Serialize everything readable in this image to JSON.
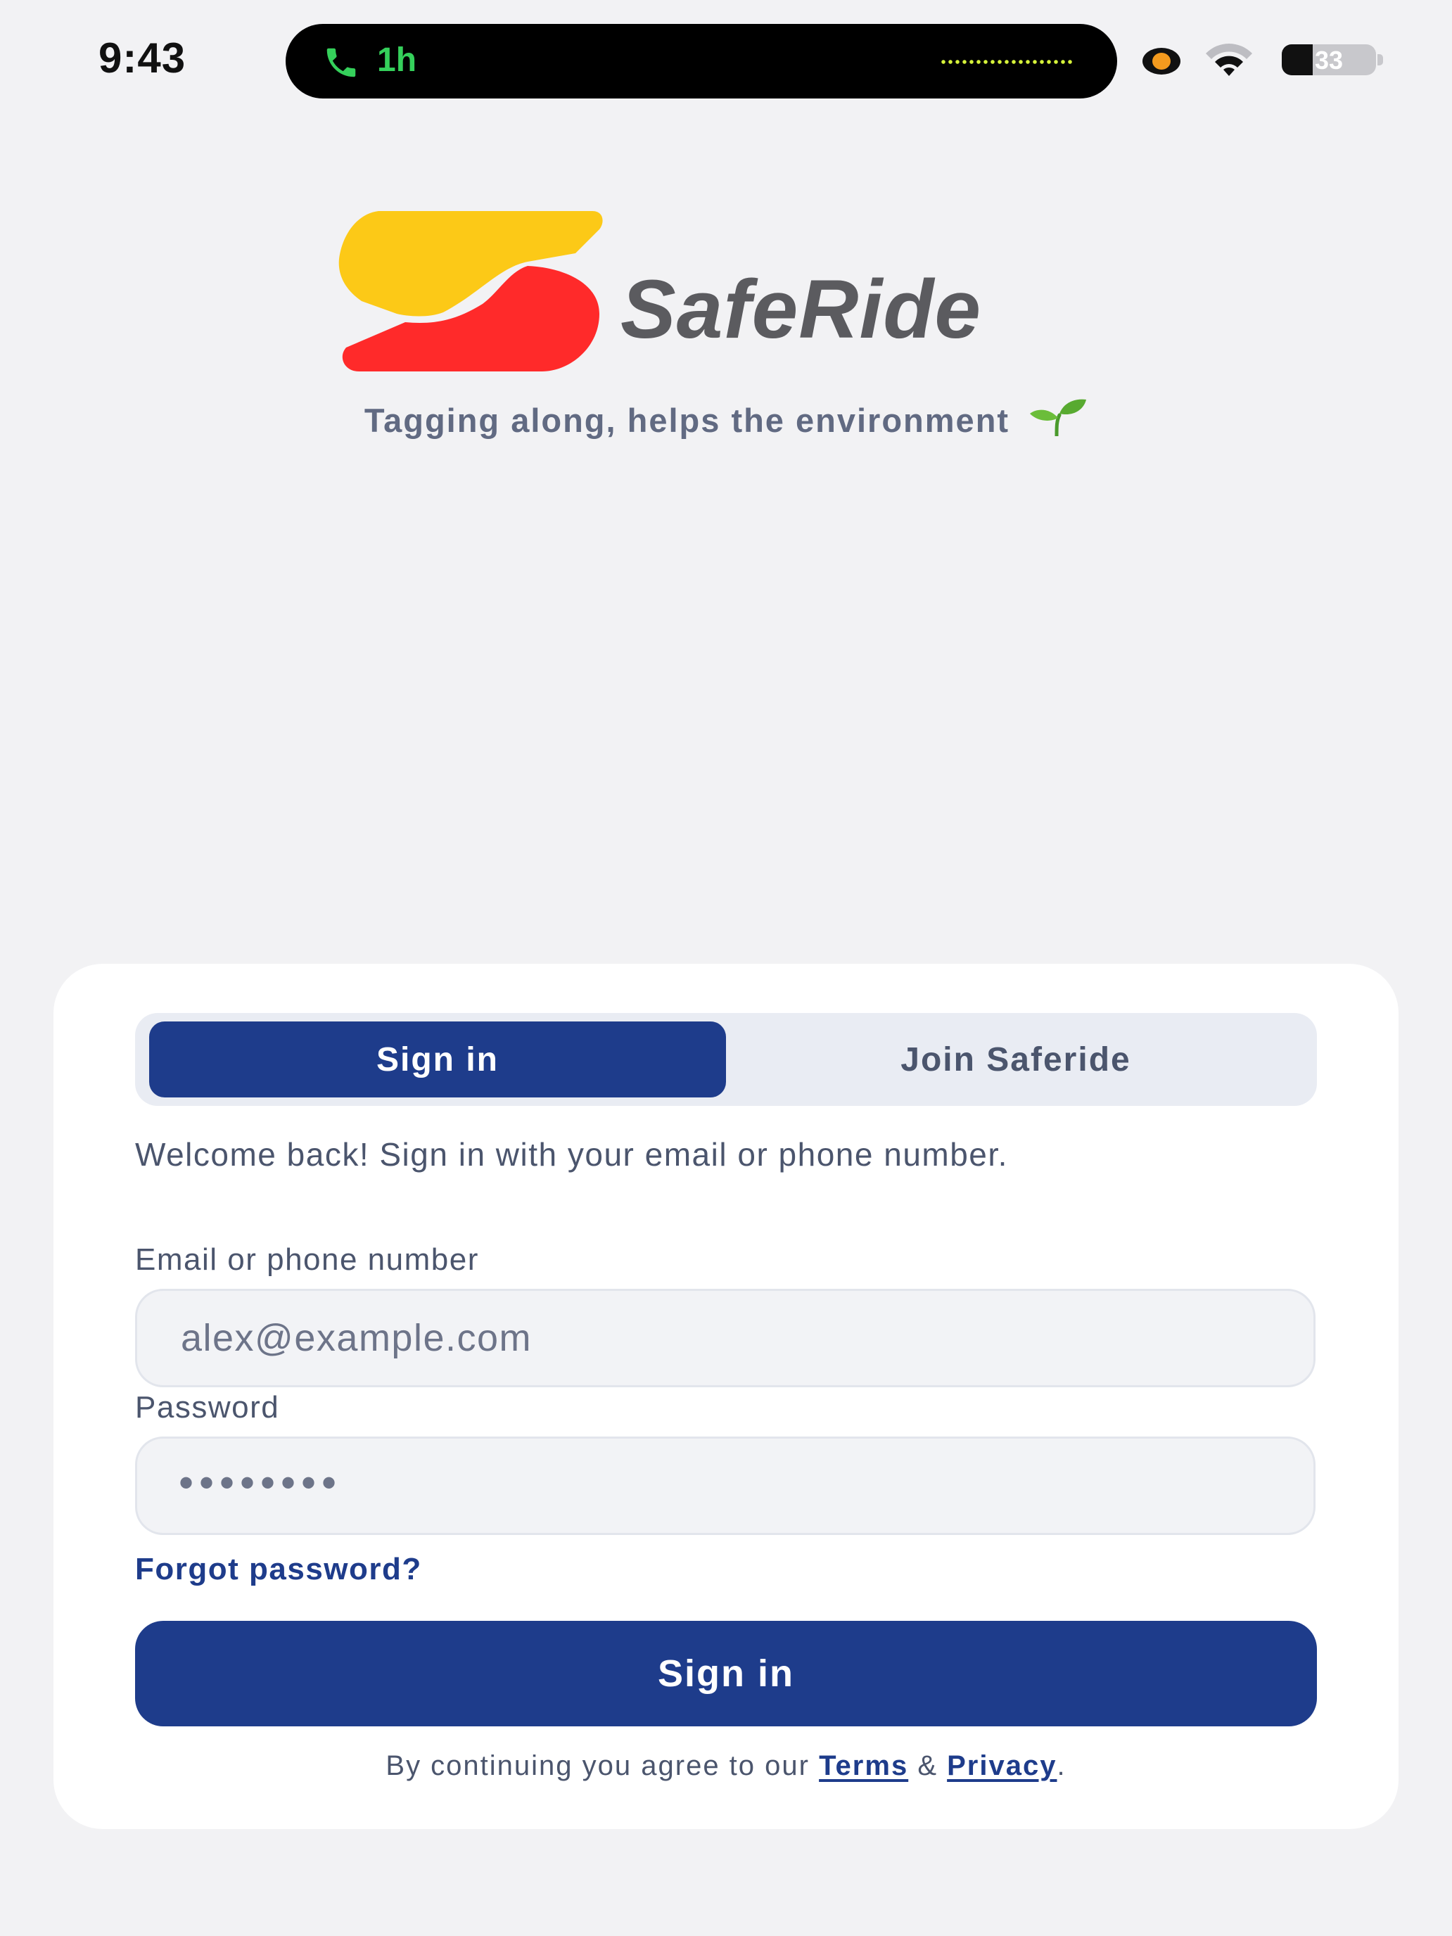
{
  "status_bar": {
    "time": "9:43",
    "call_duration": "1h",
    "battery_percent": "33",
    "battery_level": 0.33
  },
  "brand": {
    "name": "SafeRide",
    "tagline": "Tagging along, helps the environment",
    "colors": {
      "yellow": "#fcc917",
      "red": "#ff2a2a",
      "primary": "#1e3c8b"
    }
  },
  "tabs": {
    "sign_in": "Sign in",
    "join": "Join Saferide",
    "selected": "Sign in"
  },
  "form": {
    "welcome_text": "Welcome back! Sign in with your email or phone number.",
    "email_label": "Email or phone number",
    "email_placeholder": "alex@example.com",
    "password_label": "Password",
    "password_mask": "••••••••",
    "forgot_password": "Forgot password?",
    "submit_label": "Sign in"
  },
  "legal": {
    "prefix": "By continuing you agree to our",
    "terms": "Terms",
    "ampersand": "&",
    "privacy": "Privacy",
    "suffix": "."
  },
  "icons": {
    "call": "phone-icon",
    "wifi": "wifi-icon",
    "battery": "battery-icon",
    "recording": "recording-indicator-icon",
    "sprout": "seedling-icon"
  }
}
